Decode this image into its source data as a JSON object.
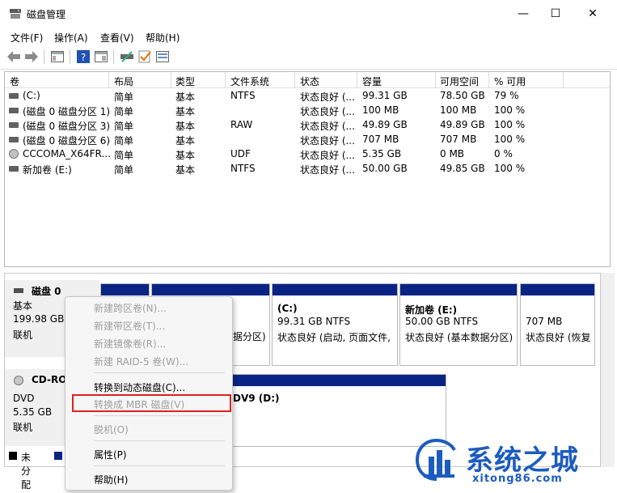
{
  "window": {
    "title": "磁盘管理",
    "min_glyph": "—",
    "max_glyph": "☐",
    "close_glyph": "✕"
  },
  "menu": [
    "文件(F)",
    "操作(A)",
    "查看(V)",
    "帮助(H)"
  ],
  "toolbar": {
    "icons": [
      "back-arrow-icon",
      "forward-arrow-icon",
      "console-tree-icon",
      "help-icon",
      "properties-icon",
      "connect-drive-icon",
      "check-icon",
      "list-view-icon"
    ]
  },
  "volume_table": {
    "headers": [
      "卷",
      "布局",
      "类型",
      "文件系统",
      "状态",
      "容量",
      "可用空间",
      "% 可用"
    ],
    "rows": [
      {
        "volume": "(C:)",
        "layout": "简单",
        "type": "基本",
        "fs": "NTFS",
        "status": "状态良好 (...",
        "capacity": "99.31 GB",
        "free": "78.50 GB",
        "pct": "79 %",
        "icon": "drive-icon"
      },
      {
        "volume": "(磁盘 0 磁盘分区 1)",
        "layout": "简单",
        "type": "基本",
        "fs": "",
        "status": "状态良好 (...",
        "capacity": "100 MB",
        "free": "100 MB",
        "pct": "100 %",
        "icon": "drive-icon"
      },
      {
        "volume": "(磁盘 0 磁盘分区 3)",
        "layout": "简单",
        "type": "基本",
        "fs": "RAW",
        "status": "状态良好 (...",
        "capacity": "49.89 GB",
        "free": "49.89 GB",
        "pct": "100 %",
        "icon": "drive-icon"
      },
      {
        "volume": "(磁盘 0 磁盘分区 6)",
        "layout": "简单",
        "type": "基本",
        "fs": "",
        "status": "状态良好 (...",
        "capacity": "707 MB",
        "free": "707 MB",
        "pct": "100 %",
        "icon": "drive-icon"
      },
      {
        "volume": "CCCOMA_X64FR...",
        "layout": "简单",
        "type": "基本",
        "fs": "UDF",
        "status": "状态良好 (...",
        "capacity": "5.35 GB",
        "free": "0 MB",
        "pct": "0 %",
        "icon": "cd-icon"
      },
      {
        "volume": "新加卷 (E:)",
        "layout": "简单",
        "type": "基本",
        "fs": "NTFS",
        "status": "状态良好 (...",
        "capacity": "50.00 GB",
        "free": "49.85 GB",
        "pct": "100 %",
        "icon": "drive-icon"
      }
    ]
  },
  "disk0": {
    "name": "磁盘 0",
    "type": "基本",
    "size": "199.98 GB",
    "state": "联机",
    "partitions": [
      {
        "name": "",
        "line1": "",
        "line2": ""
      },
      {
        "name": "",
        "line1": "",
        "line2": "据分区)"
      },
      {
        "name": "(C:)",
        "line1": "99.31 GB NTFS",
        "line2": "状态良好 (启动, 页面文件,"
      },
      {
        "name": "新加卷  (E:)",
        "line1": "50.00 GB NTFS",
        "line2": "状态良好 (基本数据分区)"
      },
      {
        "name": "",
        "line1": "707 MB",
        "line2": "状态良好 (恢复"
      }
    ]
  },
  "cdrom": {
    "name": "CD-RO",
    "type": "DVD",
    "size": "5.35 GB",
    "state": "联机",
    "partition_name": "DV9  (D:)"
  },
  "legend": [
    {
      "label": "未分配",
      "color": "#000000"
    },
    {
      "label": "",
      "color": "#0a2483"
    }
  ],
  "context_menu": {
    "items": [
      {
        "label": "新建跨区卷(N)...",
        "enabled": false
      },
      {
        "label": "新建带区卷(T)...",
        "enabled": false
      },
      {
        "label": "新建镜像卷(R)...",
        "enabled": false
      },
      {
        "label": "新建 RAID-5 卷(W)...",
        "enabled": false
      },
      {
        "label": "转换到动态磁盘(C)...",
        "enabled": true
      },
      {
        "label": "转换成 MBR 磁盘(V)",
        "enabled": false
      },
      {
        "label": "脱机(O)",
        "enabled": false
      },
      {
        "label": "属性(P)",
        "enabled": true
      },
      {
        "label": "帮助(H)",
        "enabled": true
      }
    ],
    "highlight_color": "#e02020"
  },
  "watermark": {
    "name": "系统之城",
    "url": "xitong86.com",
    "color": "#1c5cc0"
  }
}
